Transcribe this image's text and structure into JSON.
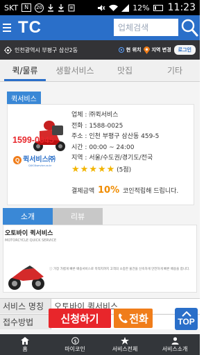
{
  "status_bar": {
    "carrier": "SKT",
    "badge": "N",
    "notification": "20",
    "battery": "12%",
    "time": "11:23"
  },
  "header": {
    "logo": "TC",
    "search_placeholder": "업체검색"
  },
  "location_bar": {
    "location": "인천광역시 부평구 삼산2동",
    "current_location_label": "현 위치",
    "change_region_label": "지역 변경",
    "login_label": "로그인"
  },
  "tabs": [
    {
      "label": "퀵/물류",
      "active": true
    },
    {
      "label": "생활서비스",
      "active": false
    },
    {
      "label": "맛집",
      "active": false
    },
    {
      "label": "기타",
      "active": false
    }
  ],
  "category_label": "퀵서비스",
  "company": {
    "thumb_phone": "1599-0045",
    "thumb_brand": "퀵서비스㈜",
    "thumb_brand_en": "QUICKservice.co.kr",
    "name": "업체 : ㈜퀵서비스",
    "phone": "전화 : 1588-0025",
    "address": "주소 : 인천 부평구 삼산동 459-5",
    "hours": "시간 : 00:00 ~ 24:00",
    "region": "지역 : 서울/수도권/경기도/전국",
    "rating_text": "(5점)",
    "rating_value": 5,
    "pay_prefix": "결제금액",
    "pay_pct": "10%",
    "pay_suffix": "코인적립해 드립니다."
  },
  "subtabs": [
    {
      "label": "소개",
      "active": true
    },
    {
      "label": "리뷰",
      "active": false
    }
  ],
  "detail": {
    "title": "오토바이 퀵서비스",
    "subtitle": "MOTORCYCLE QUICK SERVICE",
    "note": "가장 가볍게 빠른 배송서비스로 목적지까지 고객의 소중한 물건을 신속하게 안전하게 빠른 배송을 합니다."
  },
  "rows": [
    {
      "key": "서비스 명칭",
      "value": "오토바이 퀵서비스"
    },
    {
      "key": "접수방법",
      "value": ""
    }
  ],
  "actions": {
    "apply_label": "신청하기",
    "call_label": "전화",
    "top_label": "TOP"
  },
  "bottom_nav": [
    {
      "label": "홈",
      "icon": "home-icon"
    },
    {
      "label": "마이코인",
      "icon": "coin-icon"
    },
    {
      "label": "서비스전체",
      "icon": "star-icon"
    },
    {
      "label": "서비스소개",
      "icon": "person-icon"
    }
  ],
  "colors": {
    "header": "#2a6fc9",
    "accent": "#3a88d6",
    "apply": "#e8262b",
    "call": "#f07d1a",
    "star": "#f2b400",
    "pct": "#f08c00"
  }
}
